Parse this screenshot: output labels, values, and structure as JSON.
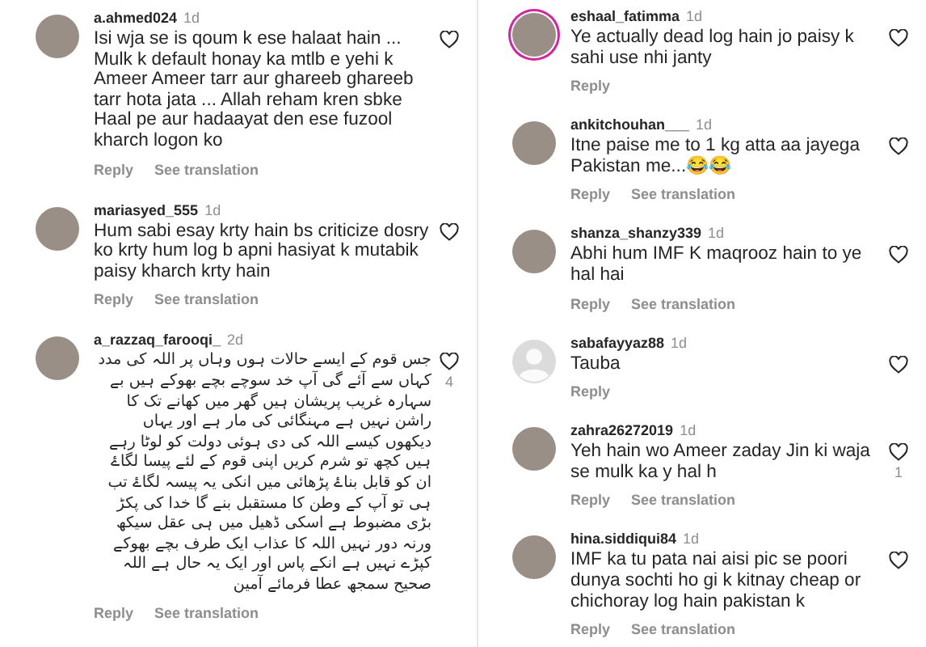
{
  "columns": [
    {
      "comments": [
        {
          "username": "a.ahmed024",
          "time": "1d",
          "default_avatar": false,
          "story_ring": false,
          "text": "Isi wja se is qoum k ese halaat hain ... Mulk k default honay ka mtlb e yehi k Ameer Ameer tarr aur ghareeb ghareeb tarr hota jata ... Allah reham kren sbke Haal pe aur hadaayat den ese fuzool kharch logon ko",
          "actions": [
            "Reply",
            "See translation"
          ]
        },
        {
          "username": "mariasyed_555",
          "time": "1d",
          "default_avatar": false,
          "story_ring": false,
          "text": "Hum sabi esay krty hain bs criticize dosry ko krty hum log b apni hasiyat k mutabik paisy kharch krty hain",
          "actions": [
            "Reply",
            "See translation"
          ]
        },
        {
          "username": "a_razzaq_farooqi_",
          "time": "2d",
          "default_avatar": false,
          "story_ring": false,
          "likes": "4",
          "text": "جس قوم کے ایسے حالات ہوں وہاں پر اللہ کی مدد کہاں سے آئے گی آپ خد سوچے بچے بھوکے ہیں بے سہارہ غریب پریشان ہیں گھر میں کھانے تک کا راشن نہیں ہے مہنگائی کی مار ہے اور یہاں دیکھوں کیسے اللہ کی دی ہوئی دولت کو لوٹا رہے ہیں کچھ تو شرم کریں اپنی قوم کے لئے پیسا لگاۓ ان کو قابل بناۓ پڑھائی میں انکی یہ پیسہ لگاۓ تب ہی تو آپ کے وطن کا مستقبل بنے گا خدا کی پکڑ بڑی مضبوط ہے اسکی ڈھیل میں ہی عقل سیکھ ورنہ دور نہیں اللہ کا عذاب ایک طرف بچے بھوکے کپڑے نہیں ہے انکے پاس اور ایک یہ حال ہے اللہ صحیح سمجھ عطا فرمائے آمین",
          "actions": [
            "Reply",
            "See translation"
          ]
        }
      ]
    },
    {
      "comments": [
        {
          "username": "eshaal_fatimma",
          "time": "1d",
          "default_avatar": false,
          "story_ring": true,
          "text": "Ye actually dead log hain jo paisy k sahi use nhi janty",
          "actions": [
            "Reply"
          ]
        },
        {
          "username": "ankitchouhan___",
          "time": "1d",
          "default_avatar": false,
          "story_ring": false,
          "text": "Itne paise me to 1 kg atta aa jayega Pakistan me...😂😂",
          "actions": [
            "Reply",
            "See translation"
          ]
        },
        {
          "username": "shanza_shanzy339",
          "time": "1d",
          "default_avatar": false,
          "story_ring": false,
          "text": "Abhi hum IMF K maqrooz hain to ye hal hai",
          "actions": [
            "Reply",
            "See translation"
          ]
        },
        {
          "username": "sabafayyaz88",
          "time": "1d",
          "default_avatar": true,
          "story_ring": false,
          "text": "Tauba",
          "actions": [
            "Reply"
          ]
        },
        {
          "username": "zahra26272019",
          "time": "1d",
          "default_avatar": false,
          "story_ring": false,
          "likes": "1",
          "text": "Yeh hain wo Ameer zaday Jin ki waja se mulk ka y hal h",
          "actions": [
            "Reply",
            "See translation"
          ]
        },
        {
          "username": "hina.siddiqui84",
          "time": "1d",
          "default_avatar": false,
          "story_ring": false,
          "text": "IMF ka tu pata nai aisi pic se poori dunya sochti ho gi k kitnay cheap or chichoray log hain pakistan k",
          "actions": [
            "Reply",
            "See translation"
          ]
        }
      ]
    }
  ]
}
